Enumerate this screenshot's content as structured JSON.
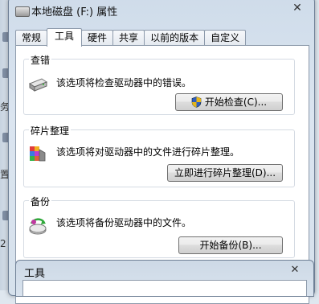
{
  "background": {
    "fragments": [
      "务",
      "置",
      "2"
    ]
  },
  "dialog": {
    "title": "本地磁盘 (F:) 属性",
    "close": "✕",
    "tabs": [
      {
        "label": "常规",
        "active": false
      },
      {
        "label": "工具",
        "active": true
      },
      {
        "label": "硬件",
        "active": false
      },
      {
        "label": "共享",
        "active": false
      },
      {
        "label": "以前的版本",
        "active": false
      },
      {
        "label": "自定义",
        "active": false
      }
    ],
    "groups": {
      "check": {
        "title": "查错",
        "description": "该选项将检查驱动器中的错误。",
        "button": "开始检查(C)..."
      },
      "defrag": {
        "title": "碎片整理",
        "description": "该选项将对驱动器中的文件进行碎片整理。",
        "button": "立即进行碎片整理(D)..."
      },
      "backup": {
        "title": "备份",
        "description": "该选项将备份驱动器中的文件。",
        "button": "开始备份(B)..."
      }
    }
  },
  "subwindow": {
    "title": "工具",
    "close": "✕"
  },
  "colors": {
    "accent": "#3b6ea5",
    "frame": "#cfdcea",
    "panel": "#ffffff"
  }
}
